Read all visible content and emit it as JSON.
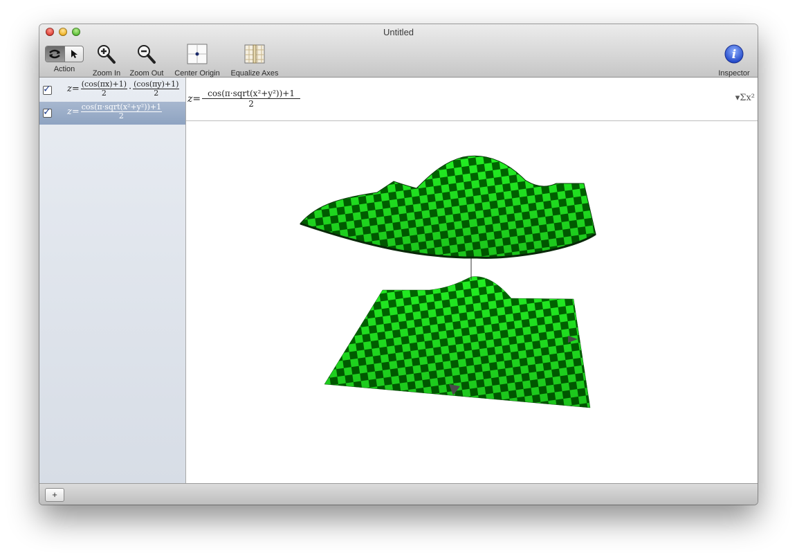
{
  "window": {
    "title": "Untitled"
  },
  "toolbar": {
    "action_label": "Action",
    "zoom_in_label": "Zoom In",
    "zoom_out_label": "Zoom Out",
    "center_origin_label": "Center Origin",
    "equalize_axes_label": "Equalize Axes",
    "inspector_label": "Inspector"
  },
  "sidebar": {
    "equations": [
      {
        "lhs": "z=",
        "frac1_num": "(cos(πx)+1)",
        "frac1_den": "2",
        "dot": "·",
        "frac2_num": "(cos(πy)+1)",
        "frac2_den": "2",
        "checked": true
      },
      {
        "lhs": "z=",
        "frac1_num": "cos(π·sqrt(x²+y²))+1",
        "frac1_den": "2",
        "checked": true,
        "selected": true
      }
    ]
  },
  "editor": {
    "lhs": "z=",
    "num": "cos(π·sqrt(x²+y²))+1",
    "den": "2",
    "sigma_label": "▾Σx²"
  },
  "plot": {
    "surface_color_light": "#22ee22",
    "surface_color_dark": "#006600"
  },
  "bottom": {
    "add_label": "+"
  }
}
